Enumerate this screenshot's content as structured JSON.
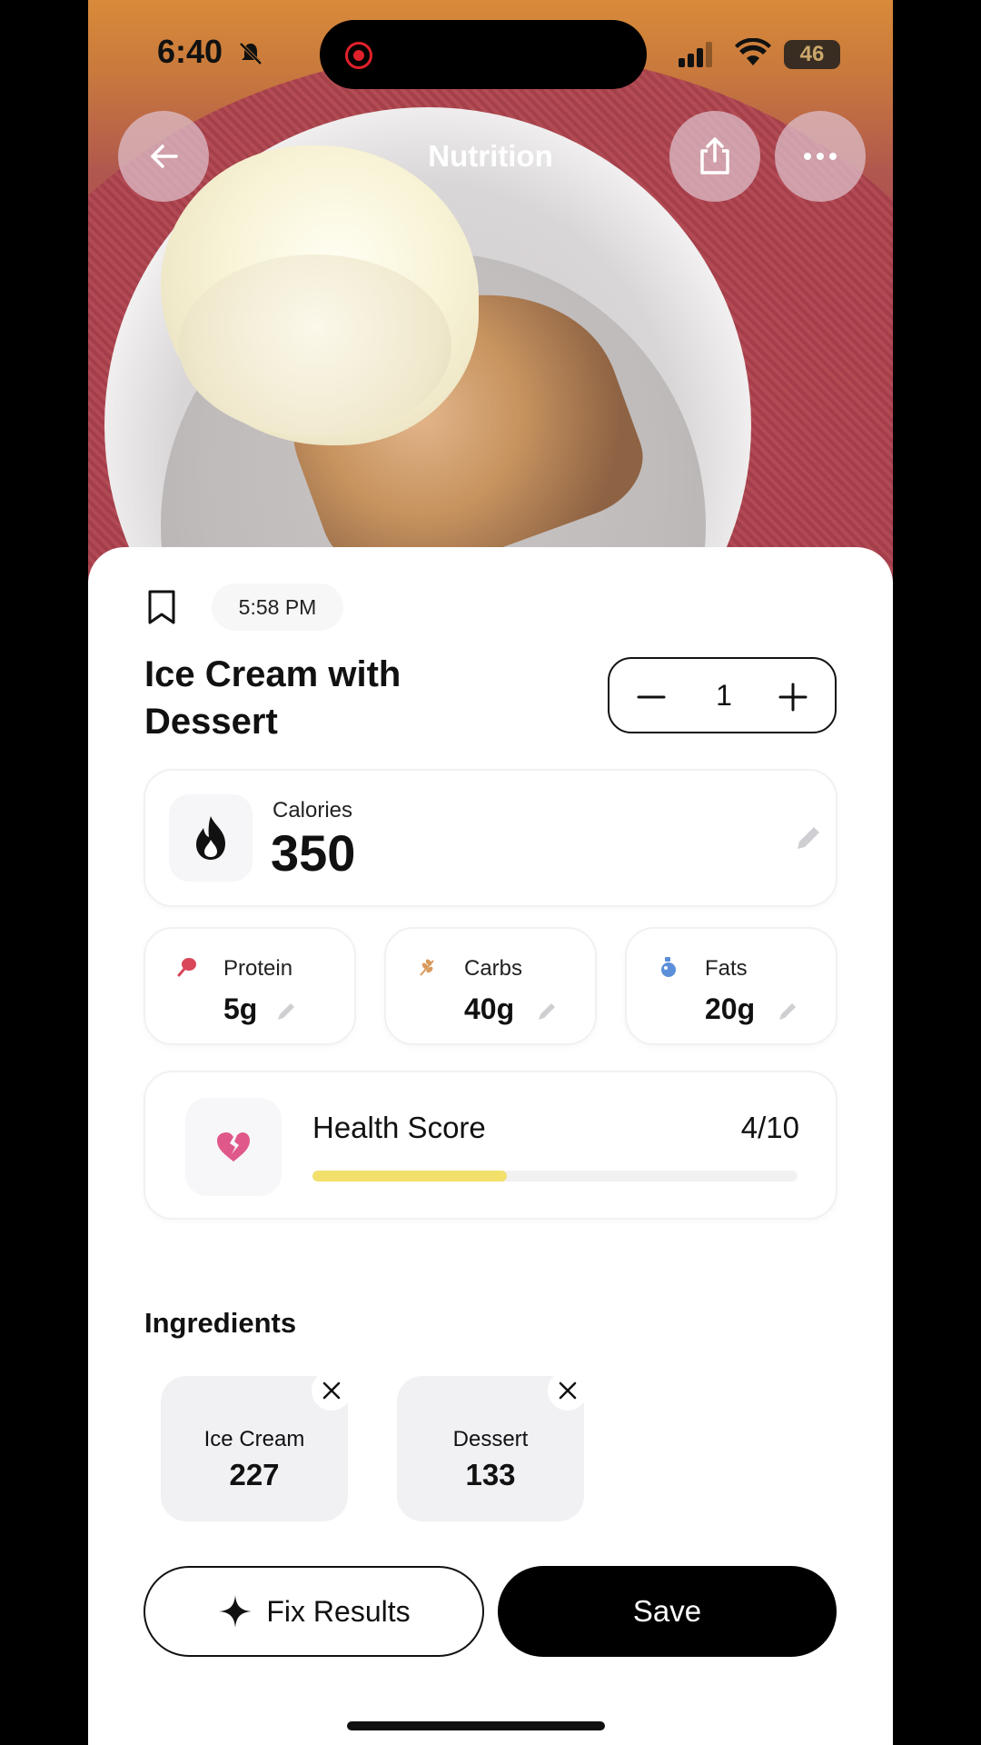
{
  "status_bar": {
    "time": "6:40",
    "battery": "46"
  },
  "header": {
    "title": "Nutrition"
  },
  "entry": {
    "time": "5:58 PM",
    "title": "Ice Cream with Dessert",
    "servings": "1"
  },
  "calories": {
    "label": "Calories",
    "value": "350"
  },
  "macros": [
    {
      "label": "Protein",
      "value": "5g",
      "icon": "drumstick-icon",
      "color": "#d9465a"
    },
    {
      "label": "Carbs",
      "value": "40g",
      "icon": "wheat-icon",
      "color": "#d99a5c"
    },
    {
      "label": "Fats",
      "value": "20g",
      "icon": "oil-drop-icon",
      "color": "#5b8fd9"
    }
  ],
  "health": {
    "label": "Health Score",
    "score": "4/10",
    "fraction": 0.4,
    "bar_color": "#f2e06b",
    "icon_color": "#e0588a"
  },
  "ingredients": {
    "title": "Ingredients",
    "items": [
      {
        "name": "Ice Cream",
        "value": "227"
      },
      {
        "name": "Dessert",
        "value": "133"
      }
    ]
  },
  "actions": {
    "fix_label": "Fix Results",
    "save_label": "Save"
  }
}
